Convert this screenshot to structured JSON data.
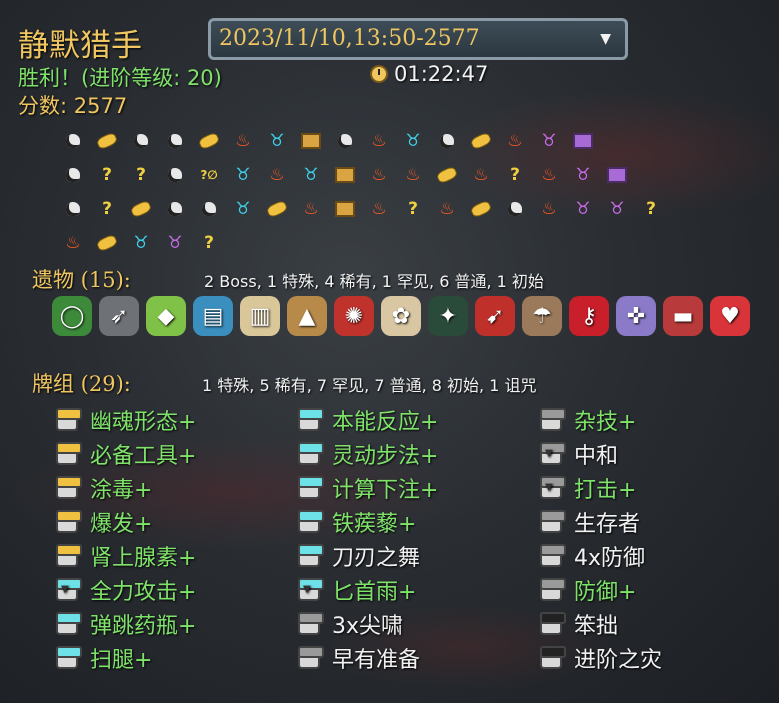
{
  "header": {
    "title": "静默猎手",
    "victory": "胜利！(进阶等级: 20)",
    "score": "分数: 2577",
    "timer": "01:22:47",
    "run_selector": "2023/11/10,13:50-2577"
  },
  "map_icons": [
    [
      "skull",
      "gold",
      "skull",
      "skull",
      "gold",
      "fire",
      "blue",
      "chest",
      "skull",
      "fire",
      "blue",
      "skull",
      "gold",
      "fire",
      "purple",
      "pchest"
    ],
    [
      "skull",
      "unk",
      "unk",
      "skull",
      "uskull",
      "blue",
      "fire",
      "blue",
      "chest",
      "fire",
      "fire",
      "gold",
      "fire",
      "unk",
      "fire",
      "purple",
      "pchest"
    ],
    [
      "skull",
      "unk",
      "gold",
      "skull",
      "skull",
      "blue",
      "gold",
      "fire",
      "chest",
      "fire",
      "unk",
      "fire",
      "gold",
      "skull",
      "fire",
      "purple",
      "purple",
      "unk"
    ],
    [
      "fire",
      "gold",
      "blue",
      "purple",
      "unk"
    ]
  ],
  "relics_section": {
    "label": "遗物 (15):",
    "summary": "2 Boss, 1 特殊, 4 稀有, 1 罕见, 6 普通, 1 初始",
    "items": [
      {
        "icon": "ring-icon",
        "glyph": "◯",
        "color": "#3d8a3a"
      },
      {
        "icon": "kunai-icon",
        "glyph": "➶",
        "color": "#6e7276"
      },
      {
        "icon": "crystal-icon",
        "glyph": "◆",
        "color": "#7fc247"
      },
      {
        "icon": "map-icon",
        "glyph": "▤",
        "color": "#3a8fbf"
      },
      {
        "icon": "scroll-icon",
        "glyph": "▥",
        "color": "#d9c79a"
      },
      {
        "icon": "pyramid-icon",
        "glyph": "▲",
        "color": "#b88a4a"
      },
      {
        "icon": "claw-icon",
        "glyph": "✺",
        "color": "#c0322c"
      },
      {
        "icon": "ginger-icon",
        "glyph": "✿",
        "color": "#d9c7a3"
      },
      {
        "icon": "beetle-icon",
        "glyph": "✦",
        "color": "#2a4a3a"
      },
      {
        "icon": "wing-boots-icon",
        "glyph": "➹",
        "color": "#c0302a"
      },
      {
        "icon": "pipe-icon",
        "glyph": "☂",
        "color": "#9a7a5a"
      },
      {
        "icon": "red-key-icon",
        "glyph": "⚷",
        "color": "#c81f2a"
      },
      {
        "icon": "compass-icon",
        "glyph": "✜",
        "color": "#8a7ac8"
      },
      {
        "icon": "pillow-icon",
        "glyph": "▬",
        "color": "#b83a3a"
      },
      {
        "icon": "strawberry-icon",
        "glyph": "♥",
        "color": "#d8343a"
      }
    ]
  },
  "deck_section": {
    "label": "牌组 (29):",
    "summary": "1 特殊, 5 稀有, 7 罕见, 7 普通, 8 初始, 1 诅咒",
    "columns": [
      [
        {
          "name": "幽魂形态+",
          "up": true,
          "jar": "#f0c040",
          "atk": false
        },
        {
          "name": "必备工具+",
          "up": true,
          "jar": "#f0c040",
          "atk": false
        },
        {
          "name": "涂毒+",
          "up": true,
          "jar": "#f0c040",
          "atk": false
        },
        {
          "name": "爆发+",
          "up": true,
          "jar": "#f0c040",
          "atk": false
        },
        {
          "name": "肾上腺素+",
          "up": true,
          "jar": "#f0c040",
          "atk": false
        },
        {
          "name": "全力攻击+",
          "up": true,
          "jar": "#6ee0e8",
          "atk": true
        },
        {
          "name": "弹跳药瓶+",
          "up": true,
          "jar": "#6ee0e8",
          "atk": false
        },
        {
          "name": "扫腿+",
          "up": true,
          "jar": "#6ee0e8",
          "atk": false
        }
      ],
      [
        {
          "name": "本能反应+",
          "up": true,
          "jar": "#6ee0e8",
          "atk": false
        },
        {
          "name": "灵动步法+",
          "up": true,
          "jar": "#6ee0e8",
          "atk": false
        },
        {
          "name": "计算下注+",
          "up": true,
          "jar": "#6ee0e8",
          "atk": false
        },
        {
          "name": "铁蒺藜+",
          "up": true,
          "jar": "#6ee0e8",
          "atk": false
        },
        {
          "name": "刀刃之舞",
          "up": false,
          "jar": "#6ee0e8",
          "atk": false
        },
        {
          "name": "匕首雨+",
          "up": true,
          "jar": "#6ee0e8",
          "atk": true
        },
        {
          "name": "3x尖啸",
          "up": false,
          "jar": "#9a9a9a",
          "atk": false
        },
        {
          "name": "早有准备",
          "up": false,
          "jar": "#9a9a9a",
          "atk": false
        }
      ],
      [
        {
          "name": "杂技+",
          "up": true,
          "jar": "#9a9a9a",
          "atk": false
        },
        {
          "name": "中和",
          "up": false,
          "jar": "#9a9a9a",
          "atk": true
        },
        {
          "name": "打击+",
          "up": true,
          "jar": "#9a9a9a",
          "atk": true
        },
        {
          "name": "生存者",
          "up": false,
          "jar": "#9a9a9a",
          "atk": false
        },
        {
          "name": "4x防御",
          "up": false,
          "jar": "#9a9a9a",
          "atk": false
        },
        {
          "name": "防御+",
          "up": true,
          "jar": "#9a9a9a",
          "atk": false
        },
        {
          "name": "笨拙",
          "up": false,
          "jar": "#222222",
          "atk": false
        },
        {
          "name": "进阶之灾",
          "up": false,
          "jar": "#222222",
          "atk": false
        }
      ]
    ]
  }
}
